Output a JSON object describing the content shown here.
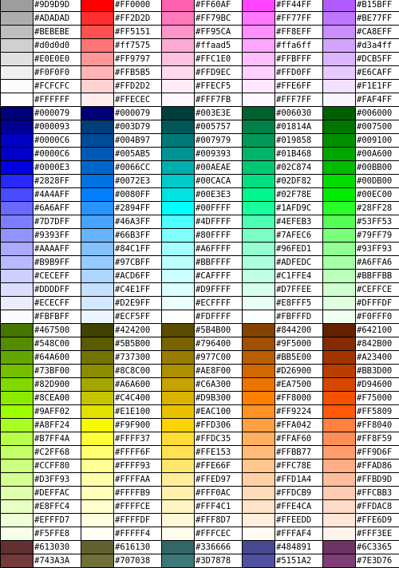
{
  "rows": [
    [
      "#9D9D9D",
      "#9D9D9D",
      "#FF0000",
      "#FF0000",
      "#FF60AF",
      "#FF60AF",
      "#FF44FF",
      "#FF44FF",
      "#B15BFF",
      "#B15BFF"
    ],
    [
      "#ADADAD",
      "#ADADAD",
      "#FF2D2D",
      "#FF2D2D",
      "#FF79BC",
      "#FF79BC",
      "#FF77FF",
      "#FF77FF",
      "#BE77FF",
      "#BE77FF"
    ],
    [
      "#BEBEBE",
      "#BEBEBE",
      "#FF5151",
      "#FF5151",
      "#FF95CA",
      "#FF95CA",
      "#FF8EFF",
      "#FF8EFF",
      "#CA8EFF",
      "#CA8EFF"
    ],
    [
      "#d0d0d0",
      "#d0d0d0",
      "#ff7575",
      "#ff7575",
      "#ffaad5",
      "#ffaad5",
      "#ffa6ff",
      "#ffa6ff",
      "#d3a4ff",
      "#d3a4ff"
    ],
    [
      "#E0E0E0",
      "#E0E0E0",
      "#FF9797",
      "#FF9797",
      "#FFC1E0",
      "#FFC1E0",
      "#FFBFFF",
      "#FFBFFF",
      "#DCB5FF",
      "#DCB5FF"
    ],
    [
      "#F0F0F0",
      "#F0F0F0",
      "#FFB5B5",
      "#FFB5B5",
      "#FFD9EC",
      "#FFD9EC",
      "#FFD0FF",
      "#FFD0FF",
      "#E6CAFF",
      "#E6CAFF"
    ],
    [
      "#FCFCFC",
      "#FCFCFC",
      "#FFD2D2",
      "#FFD2D2",
      "#FFECF5",
      "#FFECF5",
      "#FFE6FF",
      "#FFE6FF",
      "#F1E1FF",
      "#F1E1FF"
    ],
    [
      "#FFFFFF",
      "#FFFFFF",
      "#FFECEC",
      "#FFECEC",
      "#FFF7FB",
      "#FFF7FB",
      "#FFF7FF",
      "#FFF7FF",
      "#FAF4FF",
      "#FAF4FF"
    ],
    [
      "#000079",
      "#000079",
      "#000079",
      "#000079",
      "#003E3E",
      "#003E3E",
      "#006030",
      "#006030",
      "#006000",
      "#006000"
    ],
    [
      "#000093",
      "#000093",
      "#003D79",
      "#003D79",
      "#005757",
      "#005757",
      "#01814A",
      "#01814A",
      "#007500",
      "#007500"
    ],
    [
      "#0000C6",
      "#0000C6",
      "#004B97",
      "#004B97",
      "#007979",
      "#007979",
      "#019858",
      "#019858",
      "#009100",
      "#009100"
    ],
    [
      "#0000C6",
      "#0000C6",
      "#005AB5",
      "#005AB5",
      "#009393",
      "#009393",
      "#01B468",
      "#01B468",
      "#00A600",
      "#00A600"
    ],
    [
      "#0000E3",
      "#0000E3",
      "#0066CC",
      "#0066CC",
      "#00AEAE",
      "#00AEAE",
      "#02C874",
      "#02C874",
      "#00BB00",
      "#00BB00"
    ],
    [
      "#2828FF",
      "#2828FF",
      "#0072E3",
      "#0072E3",
      "#00CACA",
      "#00CACA",
      "#02DF82",
      "#02DF82",
      "#00DB00",
      "#00DB00"
    ],
    [
      "#4A4AFF",
      "#4A4AFF",
      "#0080FF",
      "#0080FF",
      "#00E3E3",
      "#00E3E3",
      "#02F78E",
      "#02F78E",
      "#00EC00",
      "#00EC00"
    ],
    [
      "#6A6AFF",
      "#6A6AFF",
      "#2894FF",
      "#2894FF",
      "#00FFFF",
      "#00FFFF",
      "#1AFD9C",
      "#1AFD9C",
      "#28FF28",
      "#28FF28"
    ],
    [
      "#7D7DFF",
      "#7D7DFF",
      "#46A3FF",
      "#46A3FF",
      "#4DFFFF",
      "#4DFFFF",
      "#4EFEB3",
      "#4EFEB3",
      "#53FF53",
      "#53FF53"
    ],
    [
      "#9393FF",
      "#9393FF",
      "#66B3FF",
      "#66B3FF",
      "#80FFFF",
      "#80FFFF",
      "#7AFEC6",
      "#7AFEC6",
      "#79FF79",
      "#79FF79"
    ],
    [
      "#AAAAFF",
      "#AAAAFF",
      "#84C1FF",
      "#84C1FF",
      "#A6FFFF",
      "#A6FFFF",
      "#96FED1",
      "#96FED1",
      "#93FF93",
      "#93FF93"
    ],
    [
      "#B9B9FF",
      "#B9B9FF",
      "#97CBFF",
      "#97CBFF",
      "#BBFFFF",
      "#BBFFFF",
      "#ADFEDC",
      "#ADFEDC",
      "#A6FFA6",
      "#A6FFA6"
    ],
    [
      "#CECEFF",
      "#CECEFF",
      "#ACD6FF",
      "#ACD6FF",
      "#CAFFFF",
      "#CAFFFF",
      "#C1FFE4",
      "#C1FFE4",
      "#BBFFBB",
      "#BBFFBB"
    ],
    [
      "#DDDDFF",
      "#DDDDFF",
      "#C4E1FF",
      "#C4E1FF",
      "#D9FFFF",
      "#D9FFFF",
      "#D7FFEE",
      "#D7FFEE",
      "#CEFFCE",
      "#CEFFCE"
    ],
    [
      "#ECECFF",
      "#ECECFF",
      "#D2E9FF",
      "#D2E9FF",
      "#ECFFFF",
      "#ECFFFF",
      "#E8FFF5",
      "#E8FFF5",
      "#DFFFDF",
      "#DFFFDF"
    ],
    [
      "#FBFBFF",
      "#FBFBFF",
      "#ECF5FF",
      "#ECF5FF",
      "#FDFFFF",
      "#FDFFFF",
      "#FBFFFD",
      "#FBFFFD",
      "#F0FFF0",
      "#F0FFF0"
    ],
    [
      "#467500",
      "#467500",
      "#424200",
      "#424200",
      "#5B4B00",
      "#5B4B00",
      "#844200",
      "#844200",
      "#642100",
      "#642100"
    ],
    [
      "#548C00",
      "#548C00",
      "#5B5B00",
      "#5B5B00",
      "#796400",
      "#796400",
      "#9F5000",
      "#9F5000",
      "#842B00",
      "#842B00"
    ],
    [
      "#64A600",
      "#64A600",
      "#737300",
      "#737300",
      "#977C00",
      "#977C00",
      "#BB5E00",
      "#BB5E00",
      "#A23400",
      "#A23400"
    ],
    [
      "#73BF00",
      "#73BF00",
      "#8C8C00",
      "#8C8C00",
      "#AE8F00",
      "#AE8F00",
      "#D26900",
      "#D26900",
      "#BB3D00",
      "#BB3D00"
    ],
    [
      "#82D900",
      "#82D900",
      "#A6A600",
      "#A6A600",
      "#C6A300",
      "#C6A300",
      "#EA7500",
      "#EA7500",
      "#D94600",
      "#D94600"
    ],
    [
      "#8CEA00",
      "#8CEA00",
      "#C4C400",
      "#C4C400",
      "#D9B300",
      "#D9B300",
      "#FF8000",
      "#FF8000",
      "#F75000",
      "#F75000"
    ],
    [
      "#9AFF02",
      "#9AFF02",
      "#E1E100",
      "#E1E100",
      "#EAC100",
      "#EAC100",
      "#FF9224",
      "#FF9224",
      "#FF5809",
      "#FF5809"
    ],
    [
      "#A8FF24",
      "#A8FF24",
      "#F9F900",
      "#F9F900",
      "#FFD306",
      "#FFD306",
      "#FFA042",
      "#FFA042",
      "#FF8040",
      "#FF8040"
    ],
    [
      "#B7FF4A",
      "#B7FF4A",
      "#FFFF37",
      "#FFFF37",
      "#FFDC35",
      "#FFDC35",
      "#FFAF60",
      "#FFAF60",
      "#FF8F59",
      "#FF8F59"
    ],
    [
      "#C2FF68",
      "#C2FF68",
      "#FFFF6F",
      "#FFFF6F",
      "#FFE153",
      "#FFE153",
      "#FFBB77",
      "#FFBB77",
      "#FF9D6F",
      "#FF9D6F"
    ],
    [
      "#CCFF80",
      "#CCFF80",
      "#FFFF93",
      "#FFFF93",
      "#FFE66F",
      "#FFE66F",
      "#FFC78E",
      "#FFC78E",
      "#FFAD86",
      "#FFAD86"
    ],
    [
      "#D3FF93",
      "#D3FF93",
      "#FFFFAA",
      "#FFFFAA",
      "#FFED97",
      "#FFED97",
      "#FFD1A4",
      "#FFD1A4",
      "#FFBD9D",
      "#FFBD9D"
    ],
    [
      "#DEFFAC",
      "#DEFFAC",
      "#FFFFB9",
      "#FFFFB9",
      "#FFF0AC",
      "#FFF0AC",
      "#FFDCB9",
      "#FFDCB9",
      "#FFCBB3",
      "#FFCBB3"
    ],
    [
      "#E8FFC4",
      "#E8FFC4",
      "#FFFFCE",
      "#FFFFCE",
      "#FFF4C1",
      "#FFF4C1",
      "#FFE4CA",
      "#FFE4CA",
      "#FFDAC8",
      "#FFDAC8"
    ],
    [
      "#EFFFD7",
      "#EFFFD7",
      "#FFFFDF",
      "#FFFFDF",
      "#FFF8D7",
      "#FFF8D7",
      "#FFEEDD",
      "#FFEEDD",
      "#FFE6D9",
      "#FFE6D9"
    ],
    [
      "#F5FFE8",
      "#F5FFE8",
      "#FFFFF4",
      "#FFFFF4",
      "#FFFCEC",
      "#FFFCEC",
      "#FFFAF4",
      "#FFFAF4",
      "#FFF3EE",
      "#FFF3EE"
    ],
    [
      "#613030",
      "#613030",
      "#616130",
      "#616130",
      "#336666",
      "#336666",
      "#484891",
      "#484891",
      "#6C3365",
      "#6C3365"
    ],
    [
      "#743A3A",
      "#743A3A",
      "#707038",
      "#707038",
      "#3D7878",
      "#3D7878",
      "#5151A2",
      "#5151A2",
      "#7E3D76",
      "#7E3D76"
    ]
  ]
}
